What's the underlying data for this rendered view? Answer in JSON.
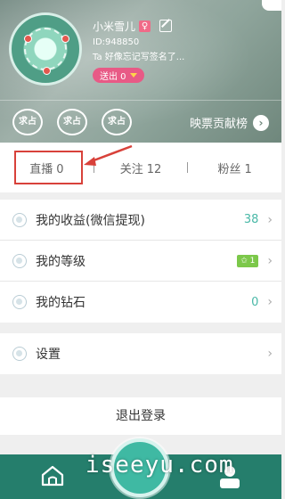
{
  "profile": {
    "name": "小米雪儿",
    "gender_symbol": "♀",
    "id_text": "ID:948850",
    "signature": "Ta 好像忘记写签名了...",
    "sent_label": "送出 0"
  },
  "header": {
    "medals": [
      "求占",
      "求占",
      "求占"
    ],
    "leaderboard_label": "映票贡献榜",
    "leaderboard_chevron": "›"
  },
  "stats": {
    "live_label": "直播",
    "live_count": "0",
    "follow_label": "关注",
    "follow_count": "12",
    "fans_label": "粉丝",
    "fans_count": "1"
  },
  "menu": {
    "earnings_label": "我的收益(微信提现)",
    "earnings_value": "38",
    "level_label": "我的等级",
    "level_badge": "✩ 1",
    "diamonds_label": "我的钻石",
    "diamonds_value": "0",
    "settings_label": "设置",
    "chevron": "›"
  },
  "logout_label": "退出登录",
  "watermark": "iseeyu.com",
  "colors": {
    "accent": "#49b8a7",
    "tabbar": "#257e6c",
    "badge_pink": "#e85a86",
    "highlight_red": "#d8413a"
  }
}
